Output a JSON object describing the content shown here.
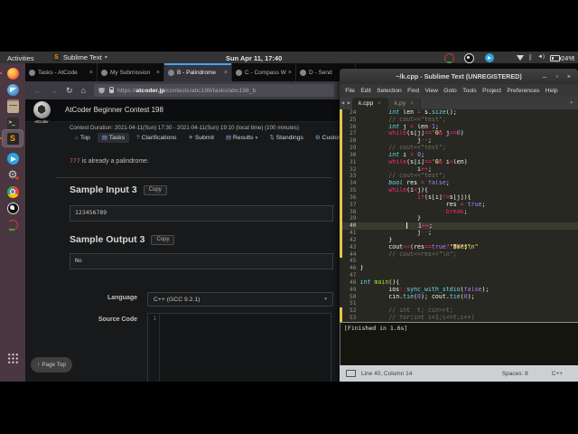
{
  "topbar": {
    "activities": "Activities",
    "app_menu": "Sublime Text",
    "clock": "Sun Apr 11, 17:40",
    "battery_percent": "24%"
  },
  "dock": {
    "items": [
      "firefox",
      "thunderbird",
      "files",
      "terminal",
      "sublime-text",
      "telegram",
      "settings",
      "chrome",
      "obs",
      "mpv"
    ],
    "app_grid": "show-applications"
  },
  "browser": {
    "tabs": [
      {
        "label": "Tasks - AtCode",
        "active": false
      },
      {
        "label": "My Submission",
        "active": false
      },
      {
        "label": "B - Palindrome",
        "active": true
      },
      {
        "label": "C - Compass W",
        "active": false
      },
      {
        "label": "D - Send",
        "active": false
      }
    ],
    "url": {
      "prefix": "https://",
      "host": "atcoder.jp",
      "path": "/contests/abc198/tasks/abc198_b"
    }
  },
  "page": {
    "brand": "AtCoder",
    "title": "AtCoder Beginner Contest 198",
    "duration": "Contest Duration: 2021-04-11(Sun) 17:30 - 2021-04-11(Sun) 19:10 (local time) (100 minutes)",
    "nav": [
      {
        "label": "Top"
      },
      {
        "label": "Tasks",
        "active": true
      },
      {
        "label": "Clarifications"
      },
      {
        "label": "Submit"
      },
      {
        "label": "Results",
        "caret": true
      },
      {
        "label": "Standings"
      },
      {
        "label": "Custom Te"
      }
    ],
    "note": {
      "code": "777",
      "text": " is already a palindrome."
    },
    "sample_input": {
      "heading": "Sample Input 3",
      "copy": "Copy",
      "value": "123456789"
    },
    "sample_output": {
      "heading": "Sample Output 3",
      "copy": "Copy",
      "value": "No"
    },
    "form": {
      "language_label": "Language",
      "language_value": "C++ (GCC 9.2.1)",
      "source_label": "Source Code",
      "first_line_number": "1"
    },
    "page_top": "Page Top"
  },
  "sublime": {
    "title": "~/k.cpp - Sublime Text (UNREGISTERED)",
    "menus": [
      "File",
      "Edit",
      "Selection",
      "Find",
      "View",
      "Goto",
      "Tools",
      "Project",
      "Preferences",
      "Help"
    ],
    "tabs": [
      {
        "label": "k.cpp",
        "active": true
      },
      {
        "label": "k.py",
        "active": false
      }
    ],
    "build_output": "[Finished in 1.6s]",
    "status": {
      "position": "Line 40, Column 14",
      "spaces": "Spaces: 8",
      "syntax": "C++"
    },
    "code": [
      {
        "n": 24,
        "git": true,
        "tok": [
          [
            "p",
            "        "
          ],
          [
            "t",
            "int"
          ],
          [
            "p",
            " len "
          ],
          [
            "k",
            "="
          ],
          [
            "p",
            " s."
          ],
          [
            "f",
            "size"
          ],
          [
            "p",
            "();"
          ]
        ]
      },
      {
        "n": 25,
        "git": true,
        "tok": [
          [
            "p",
            "        "
          ],
          [
            "c",
            "// cout<<\"test\";"
          ]
        ]
      },
      {
        "n": 26,
        "git": true,
        "tok": [
          [
            "p",
            "        "
          ],
          [
            "t",
            "int"
          ],
          [
            "p",
            " j "
          ],
          [
            "k",
            "="
          ],
          [
            "p",
            " len"
          ],
          [
            "k",
            "-"
          ],
          [
            "n2",
            "1"
          ],
          [
            "p",
            ";"
          ]
        ]
      },
      {
        "n": 27,
        "git": true,
        "tok": [
          [
            "p",
            "        "
          ],
          [
            "k",
            "while"
          ],
          [
            "p",
            "(s[j]"
          ],
          [
            "k",
            "=="
          ],
          [
            "s",
            "'0'"
          ],
          [
            "p",
            " "
          ],
          [
            "k",
            "&&"
          ],
          [
            "p",
            " j"
          ],
          [
            "k",
            ">="
          ],
          [
            "n2",
            "0"
          ],
          [
            "p",
            ")"
          ]
        ]
      },
      {
        "n": 28,
        "git": true,
        "tok": [
          [
            "p",
            "                j"
          ],
          [
            "k",
            "--"
          ],
          [
            "p",
            ";"
          ]
        ]
      },
      {
        "n": 29,
        "git": true,
        "tok": [
          [
            "p",
            "        "
          ],
          [
            "c",
            "// cout<<\"test\";"
          ]
        ]
      },
      {
        "n": 30,
        "git": true,
        "tok": [
          [
            "p",
            "        "
          ],
          [
            "t",
            "int"
          ],
          [
            "p",
            " i "
          ],
          [
            "k",
            "="
          ],
          [
            "p",
            " "
          ],
          [
            "n2",
            "0"
          ],
          [
            "p",
            ";"
          ]
        ]
      },
      {
        "n": 31,
        "git": true,
        "tok": [
          [
            "p",
            "        "
          ],
          [
            "k",
            "while"
          ],
          [
            "p",
            "(s[i]"
          ],
          [
            "k",
            "=="
          ],
          [
            "s",
            "'0'"
          ],
          [
            "p",
            " "
          ],
          [
            "k",
            "&&"
          ],
          [
            "p",
            " i"
          ],
          [
            "k",
            "<"
          ],
          [
            "p",
            "len)"
          ]
        ]
      },
      {
        "n": 32,
        "git": true,
        "tok": [
          [
            "p",
            "                i"
          ],
          [
            "k",
            "++"
          ],
          [
            "p",
            ";"
          ]
        ]
      },
      {
        "n": 33,
        "git": true,
        "tok": [
          [
            "p",
            "        "
          ],
          [
            "c",
            "// cout<<\"test\";"
          ]
        ]
      },
      {
        "n": 34,
        "git": true,
        "tok": [
          [
            "p",
            "        "
          ],
          [
            "t",
            "bool"
          ],
          [
            "p",
            " res "
          ],
          [
            "k",
            "="
          ],
          [
            "p",
            " "
          ],
          [
            "n2",
            "false"
          ],
          [
            "p",
            ";"
          ]
        ]
      },
      {
        "n": 35,
        "git": true,
        "tok": [
          [
            "p",
            "        "
          ],
          [
            "k",
            "while"
          ],
          [
            "p",
            "(i"
          ],
          [
            "k",
            "<"
          ],
          [
            "p",
            "j){"
          ]
        ]
      },
      {
        "n": 36,
        "git": true,
        "tok": [
          [
            "p",
            "                "
          ],
          [
            "k",
            "if"
          ],
          [
            "p",
            "(s[i]"
          ],
          [
            "k",
            "!="
          ],
          [
            "p",
            "s[j]){"
          ]
        ]
      },
      {
        "n": 37,
        "git": true,
        "tok": [
          [
            "p",
            "                        res "
          ],
          [
            "k",
            "="
          ],
          [
            "p",
            " "
          ],
          [
            "n2",
            "true"
          ],
          [
            "p",
            ";"
          ]
        ]
      },
      {
        "n": 38,
        "git": true,
        "tok": [
          [
            "p",
            "                        "
          ],
          [
            "k",
            "break"
          ],
          [
            "p",
            ";"
          ]
        ]
      },
      {
        "n": 39,
        "git": true,
        "tok": [
          [
            "p",
            "                }"
          ]
        ]
      },
      {
        "n": 40,
        "git": true,
        "hl": true,
        "tok": [
          [
            "p",
            "             "
          ],
          [
            "cur",
            ""
          ],
          [
            "p",
            "   i"
          ],
          [
            "k",
            "++"
          ],
          [
            "p",
            ";"
          ]
        ]
      },
      {
        "n": 41,
        "git": true,
        "tok": [
          [
            "p",
            "                j"
          ],
          [
            "k",
            "--"
          ],
          [
            "p",
            ";"
          ]
        ]
      },
      {
        "n": 42,
        "git": true,
        "tok": [
          [
            "p",
            "        }"
          ]
        ]
      },
      {
        "n": 43,
        "git": true,
        "tok": [
          [
            "p",
            "        cout"
          ],
          [
            "k",
            "<<"
          ],
          [
            "p",
            "(res"
          ],
          [
            "k",
            "=="
          ],
          [
            "n2",
            "true"
          ],
          [
            "k",
            "?"
          ],
          [
            "s",
            "\"No\""
          ],
          [
            "k",
            ":"
          ],
          [
            "s",
            "\"Yes\""
          ],
          [
            "p",
            ")"
          ],
          [
            "k",
            "<<"
          ],
          [
            "s",
            "\"\\n\""
          ],
          [
            "p",
            ";"
          ]
        ]
      },
      {
        "n": 44,
        "git": true,
        "tok": [
          [
            "p",
            "        "
          ],
          [
            "c",
            "// cout<<res<<\"\\n\";"
          ]
        ]
      },
      {
        "n": 45,
        "git": false,
        "tok": []
      },
      {
        "n": 46,
        "git": false,
        "tok": [
          [
            "p",
            "}"
          ]
        ]
      },
      {
        "n": 47,
        "git": false,
        "tok": []
      },
      {
        "n": 48,
        "git": false,
        "tok": [
          [
            "t",
            "int"
          ],
          [
            "p",
            " "
          ],
          [
            "fn",
            "main"
          ],
          [
            "p",
            "(){"
          ]
        ]
      },
      {
        "n": 49,
        "git": false,
        "tok": [
          [
            "p",
            "        ios"
          ],
          [
            "k",
            "::"
          ],
          [
            "f",
            "sync_with_stdio"
          ],
          [
            "p",
            "("
          ],
          [
            "n2",
            "false"
          ],
          [
            "p",
            ");"
          ]
        ]
      },
      {
        "n": 50,
        "git": false,
        "tok": [
          [
            "p",
            "        cin."
          ],
          [
            "f",
            "tie"
          ],
          [
            "p",
            "("
          ],
          [
            "n2",
            "0"
          ],
          [
            "p",
            "); cout."
          ],
          [
            "f",
            "tie"
          ],
          [
            "p",
            "("
          ],
          [
            "n2",
            "0"
          ],
          [
            "p",
            ");"
          ]
        ]
      },
      {
        "n": 51,
        "git": false,
        "tok": []
      },
      {
        "n": 52,
        "git": true,
        "tok": [
          [
            "p",
            "        "
          ],
          [
            "c",
            "// int  t; cin>>t;"
          ]
        ]
      },
      {
        "n": 53,
        "git": true,
        "tok": [
          [
            "p",
            "        "
          ],
          [
            "c",
            "// for(int i=1;i<=t;i++)"
          ]
        ]
      }
    ]
  },
  "colors": {
    "monokai_bg": "#272822",
    "keyword": "#f92672",
    "type": "#66d9ef",
    "string": "#e6db74",
    "constant": "#ae81ff",
    "comment": "#75715e",
    "function_def": "#a6e22e",
    "git_modified": "#e0c64f",
    "firefox_accent": "#45a1ff",
    "ubuntu_dock": "#4a3742",
    "status_bar_bg": "#cdd0d3",
    "inline_code_red": "#d8695a"
  }
}
